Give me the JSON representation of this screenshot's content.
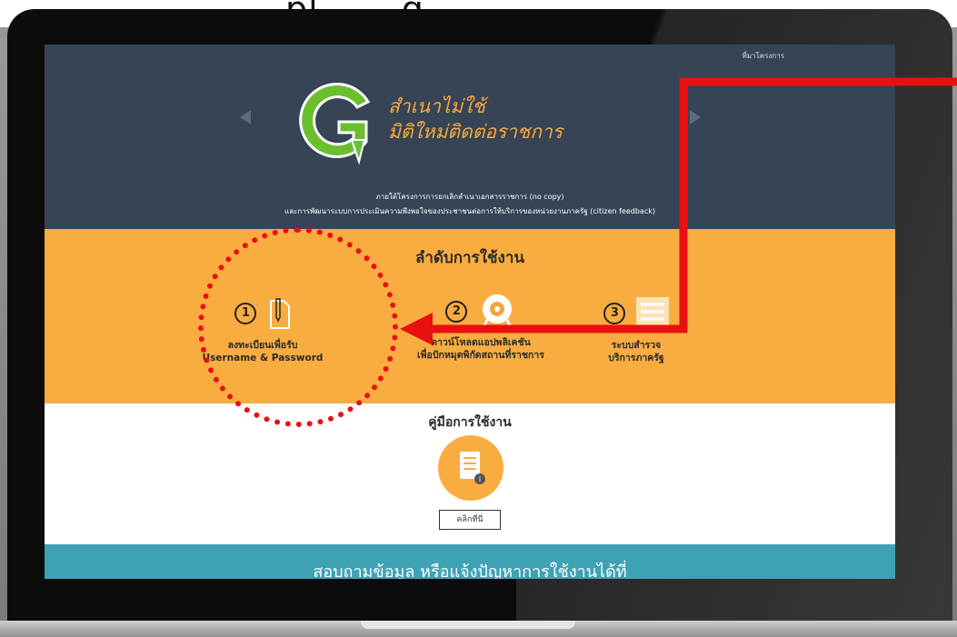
{
  "caption": {
    "text": "…pl… …g…"
  },
  "screen": {
    "top_link": "ที่มาโครงการ",
    "logo_letter": "G",
    "logo_title_line1": "สำเนาไม่ใช้",
    "logo_title_line2": "มิติใหม่ติดต่อราชการ",
    "subtitle_line1": "ภายใต้โครงการการยกเลิกสำเนาเอกสารราชการ (no copy)",
    "subtitle_line2": "และการพัฒนาระบบการประเมินความพึงพอใจของประชาชนต่อการให้บริการของหน่วยงานภาครัฐ (citizen feedback)",
    "steps_title": "ลำดับการใช้งาน",
    "steps": [
      {
        "number": "1",
        "line1": "ลงทะเบียนเพื่อรับ",
        "line2": "Username & Password",
        "icon": "document-pen-icon"
      },
      {
        "number": "2",
        "line1": "ดาวน์โหลดแอปพลิเคชัน",
        "line2": "เพื่อปักหมุดพิกัดสถานที่ราชการ",
        "icon": "location-pin-icon"
      },
      {
        "number": "3",
        "line1": "ระบบสำรวจ",
        "line2": "บริการภาครัฐ",
        "icon": "survey-list-icon"
      }
    ],
    "manual_title": "คู่มือการใช้งาน",
    "manual_button": "คลิกที่นี่",
    "footer_text": "สอบถามข้อมูล หรือแจ้งปัญหาการใช้งานได้ที่"
  },
  "colors": {
    "hero_bg": "#364456",
    "accent_orange": "#f9ac40",
    "footer_teal": "#3ea2b5",
    "annotation_red": "#e81010",
    "logo_green": "#6abf2e"
  }
}
